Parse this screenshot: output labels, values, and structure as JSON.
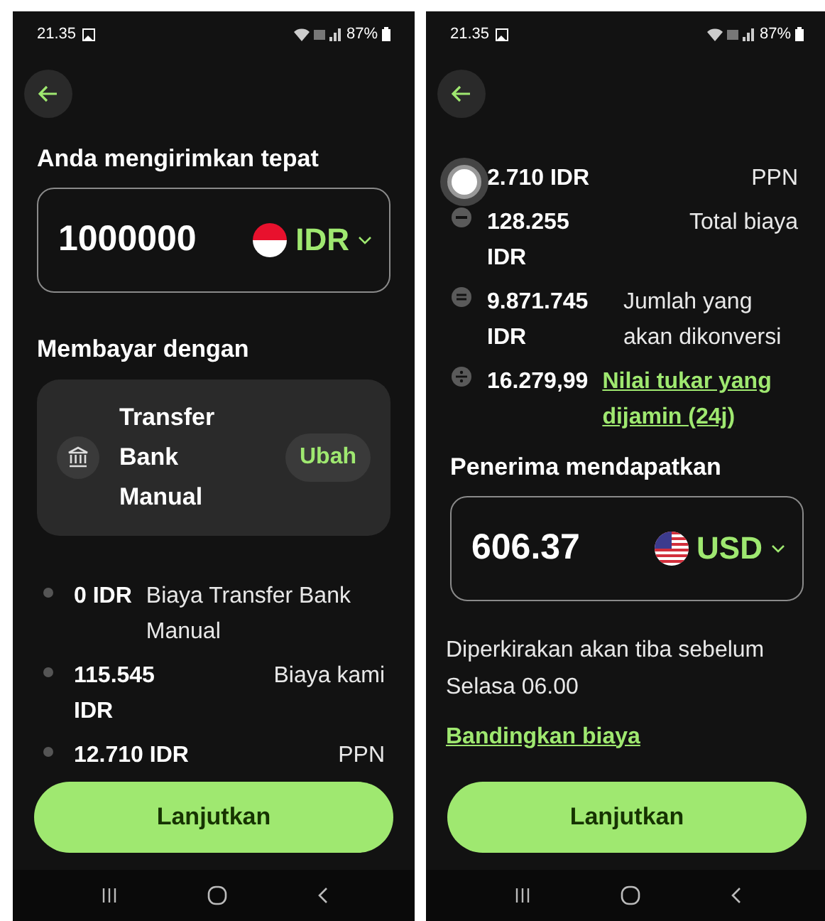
{
  "screens": [
    {
      "status_bar": {
        "time": "21.35",
        "battery": "87%"
      },
      "send_label": "Anda mengirimkan tepat",
      "send_field": {
        "amount": "1000000",
        "currency": "IDR",
        "kind": "indonesia"
      },
      "pay_label": "Membayar dengan",
      "payment_method": {
        "name": "Transfer Bank Manual",
        "action": "Ubah"
      },
      "fees": [
        {
          "kind": "dot",
          "amount": "0 IDR",
          "label": "Biaya Transfer Bank Manual",
          "link": false
        },
        {
          "kind": "dot",
          "amount": "115.545 IDR",
          "label": "Biaya kami",
          "link": false
        },
        {
          "kind": "dot",
          "amount": "12.710 IDR",
          "label": "PPN",
          "link": false
        }
      ],
      "button": "Lanjutkan",
      "touch_indicator": false
    },
    {
      "status_bar": {
        "time": "21.35",
        "battery": "87%"
      },
      "fees": [
        {
          "kind": "dot",
          "amount": "2.710 IDR",
          "label": "PPN",
          "link": false
        },
        {
          "kind": "minus",
          "amount": "128.255 IDR",
          "label": "Total biaya",
          "link": false
        },
        {
          "kind": "equals",
          "amount": "9.871.745 IDR",
          "label": "Jumlah yang akan dikonversi",
          "link": false
        },
        {
          "kind": "divide",
          "amount": "16.279,99",
          "label": "Nilai tukar yang dijamin (24j)",
          "link": true
        }
      ],
      "receive_label": "Penerima mendapatkan",
      "receive_field": {
        "amount": "606.37",
        "currency": "USD",
        "kind": "usa"
      },
      "arrival": "Diperkirakan akan tiba sebelum Selasa 06.00",
      "compare_link": "Bandingkan biaya",
      "button": "Lanjutkan",
      "touch_indicator": true
    }
  ]
}
